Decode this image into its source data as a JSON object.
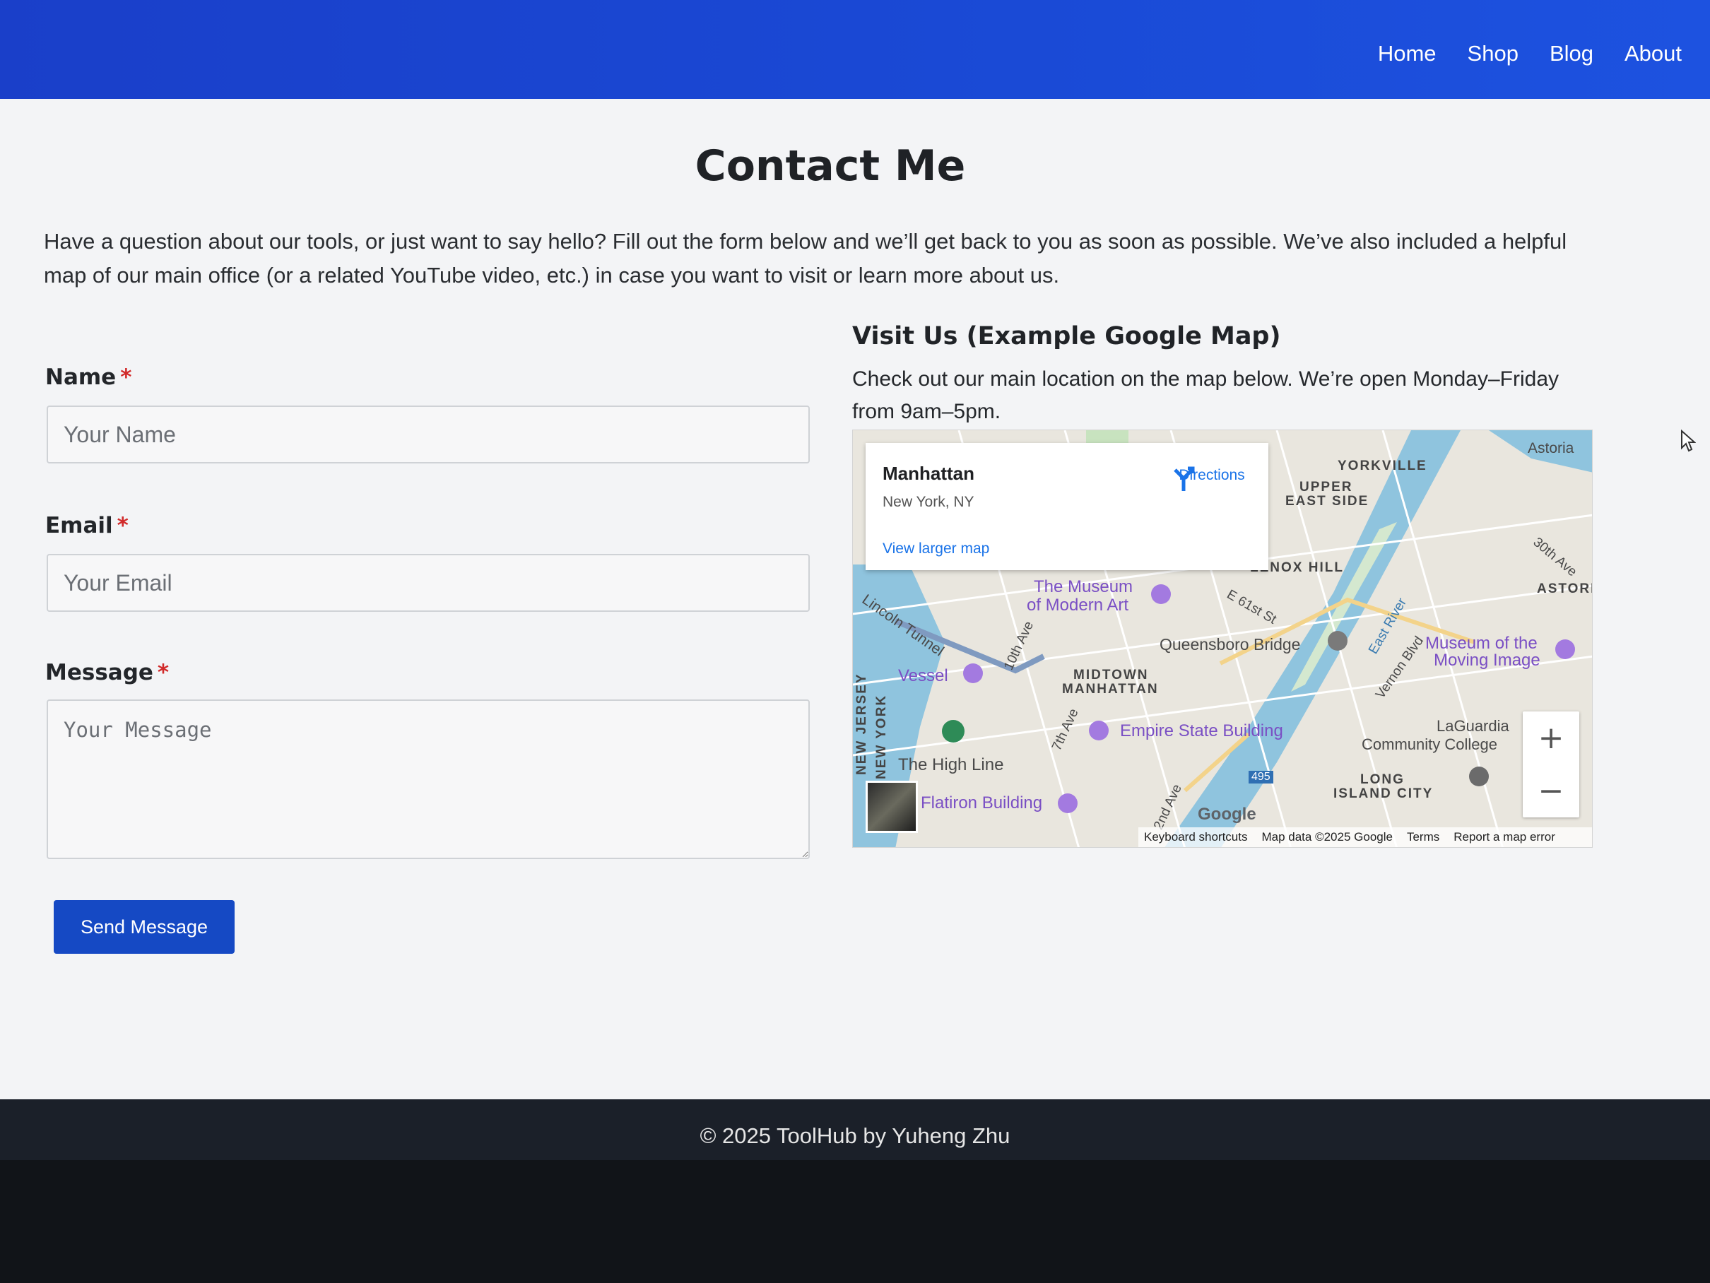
{
  "nav": {
    "items": [
      {
        "label": "Home"
      },
      {
        "label": "Shop"
      },
      {
        "label": "Blog"
      },
      {
        "label": "About"
      }
    ]
  },
  "page": {
    "title": "Contact Me",
    "intro": "Have a question about our tools, or just want to say hello? Fill out the form below and we’ll get back to you as soon as possible. We’ve also included a helpful map of our main office (or a related YouTube video, etc.) in case you want to visit or learn more about us."
  },
  "form": {
    "name_label": "Name",
    "name_placeholder": "Your Name",
    "email_label": "Email",
    "email_placeholder": "Your Email",
    "message_label": "Message",
    "message_placeholder": "Your Message",
    "required_mark": "*",
    "submit_label": "Send Message"
  },
  "visit": {
    "title": "Visit Us (Example Google Map)",
    "text": "Check out our main location on the map below. We’re open Monday–Friday from 9am–5pm."
  },
  "map": {
    "place_name": "Manhattan",
    "place_address": "New York, NY",
    "directions_label": "Directions",
    "larger_map_label": "View larger map",
    "zoom_in": "+",
    "zoom_out": "−",
    "logo": "Google",
    "attribution": {
      "shortcuts": "Keyboard shortcuts",
      "data": "Map data ©2025 Google",
      "terms": "Terms",
      "report": "Report a map error"
    },
    "labels": {
      "yorkville": "YORKVILLE",
      "upper_east_side_1": "UPPER",
      "upper_east_side_2": "EAST SIDE",
      "lenox_hill": "LENOX HILL",
      "astoria": "Astoria",
      "astoria_caps": "ASTORI",
      "moma_1": "The Museum",
      "moma_2": "of Modern Art",
      "queensboro": "Queensboro Bridge",
      "moving_image_1": "Museum of the",
      "moving_image_2": "Moving Image",
      "vessel": "Vessel",
      "midtown_1": "MIDTOWN",
      "midtown_2": "MANHATTAN",
      "empire": "Empire State Building",
      "laguardia_1": "LaGuardia",
      "laguardia_2": "Community College",
      "long_island_1": "LONG",
      "long_island_2": "ISLAND CITY",
      "high_line": "The High Line",
      "flatiron": "Flatiron Building",
      "lincoln_tunnel": "Lincoln Tunnel",
      "new_jersey": "NEW JERSEY",
      "new_york": "NEW YORK",
      "tenth_ave": "10th Ave",
      "seventh_ave": "7th Ave",
      "second_ave": "2nd Ave",
      "e61": "E 61st St",
      "thirtieth_ave": "30th Ave",
      "vernon": "Vernon Blvd",
      "east_river": "East River",
      "i495": "495"
    }
  },
  "footer": {
    "text": "© 2025 ToolHub by Yuheng Zhu"
  }
}
